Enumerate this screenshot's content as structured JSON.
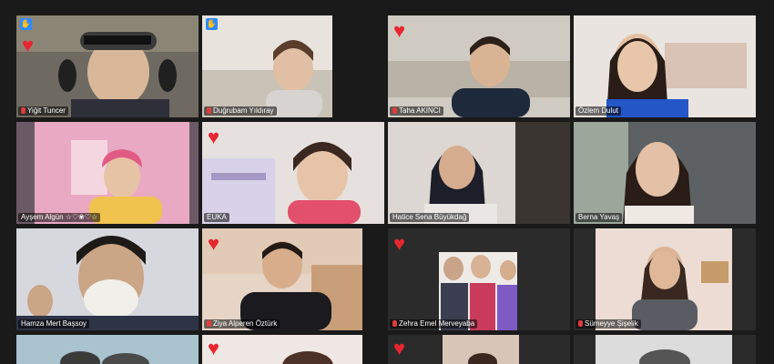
{
  "meeting": {
    "participants": [
      {
        "name": "Yiğit Tuncer",
        "icon": "raised-hand-icon",
        "reaction": "heart-icon"
      },
      {
        "name": "Duğrubam Yıldıray",
        "icon": "raised-hand-icon"
      },
      {
        "name": "Taha AKINCI",
        "reaction": "heart-icon"
      },
      {
        "name": "Özlem Dulut"
      },
      {
        "name": "Ayşem Algün ☆♡❀♡☆",
        "reaction": "none"
      },
      {
        "name": "EUKA",
        "reaction": "heart-icon"
      },
      {
        "name": "Hatice Sena Büyükdağ"
      },
      {
        "name": "Berna Yavaş",
        "active": true
      },
      {
        "name": "Hamza Mert Başsoy"
      },
      {
        "name": "Ziya Alperen Öztürk",
        "reaction": "heart-icon"
      },
      {
        "name": "Zehra Emel Merveyaba",
        "reaction": "heart-icon"
      },
      {
        "name": "Sümeyye Şişelik"
      },
      {
        "name": ""
      },
      {
        "name": "",
        "reaction": "heart-icon"
      },
      {
        "name": "",
        "reaction": "heart-icon"
      },
      {
        "name": ""
      }
    ]
  },
  "colors": {
    "background": "#1a1a1a",
    "active_speaker": "#a6d85a",
    "heart": "#e8262f",
    "raised_hand": "#2d8cff",
    "muted_mic": "#e23b3b"
  }
}
